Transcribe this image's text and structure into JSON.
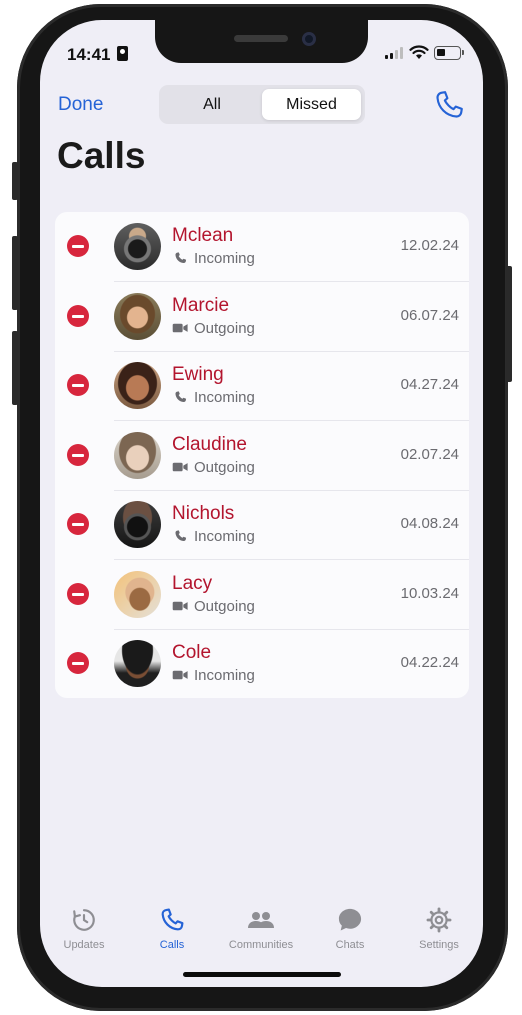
{
  "status_bar": {
    "time": "14:41"
  },
  "header": {
    "done_label": "Done",
    "segments": [
      "All",
      "Missed"
    ],
    "selected_segment": "Missed",
    "title": "Calls",
    "new_call_icon": "phone-icon"
  },
  "calls": [
    {
      "name": "Mclean",
      "type": "Incoming",
      "media": "audio",
      "date": "12.02.24"
    },
    {
      "name": "Marcie",
      "type": "Outgoing",
      "media": "video",
      "date": "06.07.24"
    },
    {
      "name": "Ewing",
      "type": "Incoming",
      "media": "audio",
      "date": "04.27.24"
    },
    {
      "name": "Claudine",
      "type": "Outgoing",
      "media": "video",
      "date": "02.07.24"
    },
    {
      "name": "Nichols",
      "type": "Incoming",
      "media": "audio",
      "date": "04.08.24"
    },
    {
      "name": "Lacy",
      "type": "Outgoing",
      "media": "video",
      "date": "10.03.24"
    },
    {
      "name": "Cole",
      "type": "Incoming",
      "media": "video",
      "date": "04.22.24"
    }
  ],
  "tabbar": {
    "tabs": [
      {
        "label": "Updates",
        "icon": "updates-icon"
      },
      {
        "label": "Calls",
        "icon": "phone-icon"
      },
      {
        "label": "Communities",
        "icon": "communities-icon"
      },
      {
        "label": "Chats",
        "icon": "chat-bubble-icon"
      },
      {
        "label": "Settings",
        "icon": "gear-icon"
      }
    ],
    "active": "Calls"
  },
  "colors": {
    "accent": "#2563d6",
    "missed_name": "#b3152e",
    "delete": "#d7263d",
    "background": "#efeef6",
    "secondary_text": "#6b6b70"
  }
}
